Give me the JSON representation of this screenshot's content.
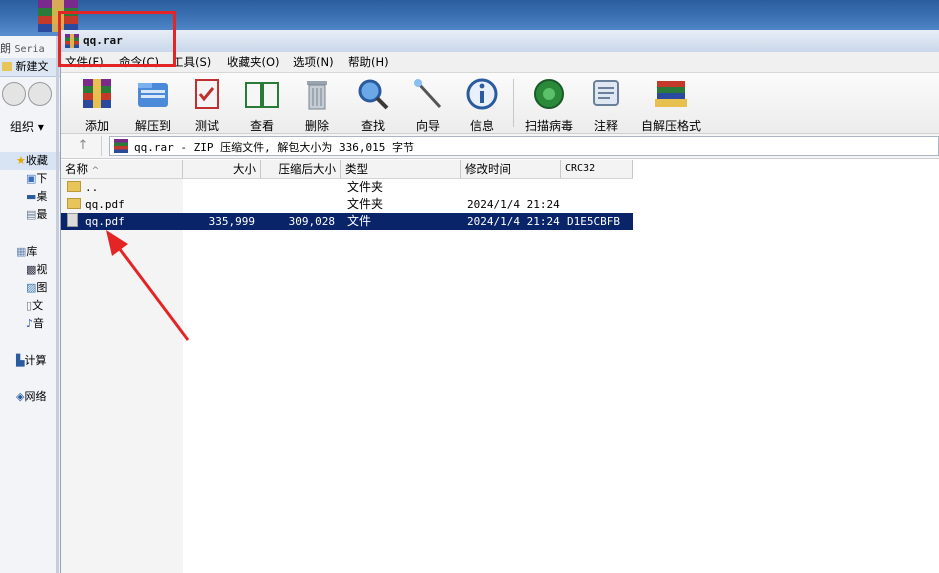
{
  "desktop": {
    "left_label": "Seria"
  },
  "explorer": {
    "new_folder": "新建文",
    "organize": "组织",
    "favorites": "收藏",
    "fav_items": [
      "下",
      "桌",
      "最"
    ],
    "library": "库",
    "lib_items": [
      "视",
      "图",
      "文",
      "音"
    ],
    "computer": "计算",
    "network": "网络"
  },
  "window": {
    "title": "qq.rar"
  },
  "menu": [
    "文件(F)",
    "命令(C)",
    "工具(S)",
    "收藏夹(O)",
    "选项(N)",
    "帮助(H)"
  ],
  "toolbar": [
    {
      "label": "添加",
      "icon": "add-archive-icon"
    },
    {
      "label": "解压到",
      "icon": "extract-icon"
    },
    {
      "label": "测试",
      "icon": "test-icon"
    },
    {
      "label": "查看",
      "icon": "view-book-icon"
    },
    {
      "label": "删除",
      "icon": "trash-icon"
    },
    {
      "label": "查找",
      "icon": "find-magnifier-icon"
    },
    {
      "label": "向导",
      "icon": "wizard-wand-icon"
    },
    {
      "label": "信息",
      "icon": "info-icon"
    },
    {
      "label": "扫描病毒",
      "icon": "virus-scan-icon"
    },
    {
      "label": "注释",
      "icon": "comment-icon"
    },
    {
      "label": "自解压格式",
      "icon": "sfx-icon"
    }
  ],
  "address": {
    "text": "qq.rar - ZIP 压缩文件, 解包大小为 336,015 字节",
    "up_symbol": "↑"
  },
  "columns": {
    "name": "名称",
    "size": "大小",
    "packed": "压缩后大小",
    "type": "类型",
    "modified": "修改时间",
    "crc": "CRC32",
    "sort_arrow": "^"
  },
  "files": [
    {
      "name": "..",
      "size": "",
      "packed": "",
      "type": "文件夹",
      "modified": "",
      "crc": "",
      "selected": false
    },
    {
      "name": "qq.pdf",
      "size": "",
      "packed": "",
      "type": "文件夹",
      "modified": "2024/1/4 21:24",
      "crc": "",
      "selected": false
    },
    {
      "name": "qq.pdf",
      "size": "335,999",
      "packed": "309,028",
      "type": "文件",
      "modified": "2024/1/4 21:24",
      "crc": "D1E5CBFB",
      "selected": true
    }
  ],
  "colors": {
    "selection": "#0a246a",
    "annotation": "#e42525",
    "desktop": "#3f76b8"
  }
}
